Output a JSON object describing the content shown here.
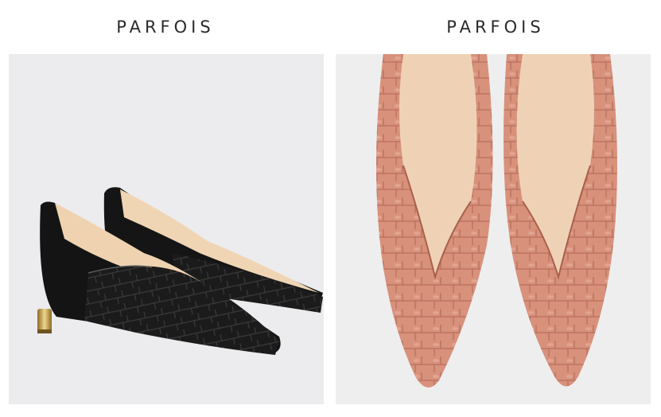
{
  "panels": [
    {
      "brand": "PARFOIS",
      "image": {
        "icon": "black-croc-pointed-flat-pair"
      }
    },
    {
      "brand": "PARFOIS",
      "image": {
        "icon": "pink-croc-pointed-flat-pair-topdown"
      }
    }
  ],
  "colors": {
    "background": "#ececee",
    "black_shoe": "#1a1a1a",
    "pink_shoe": "#d9937c",
    "lining": "#efd3b3",
    "gold_heel": "#c9a24c"
  }
}
